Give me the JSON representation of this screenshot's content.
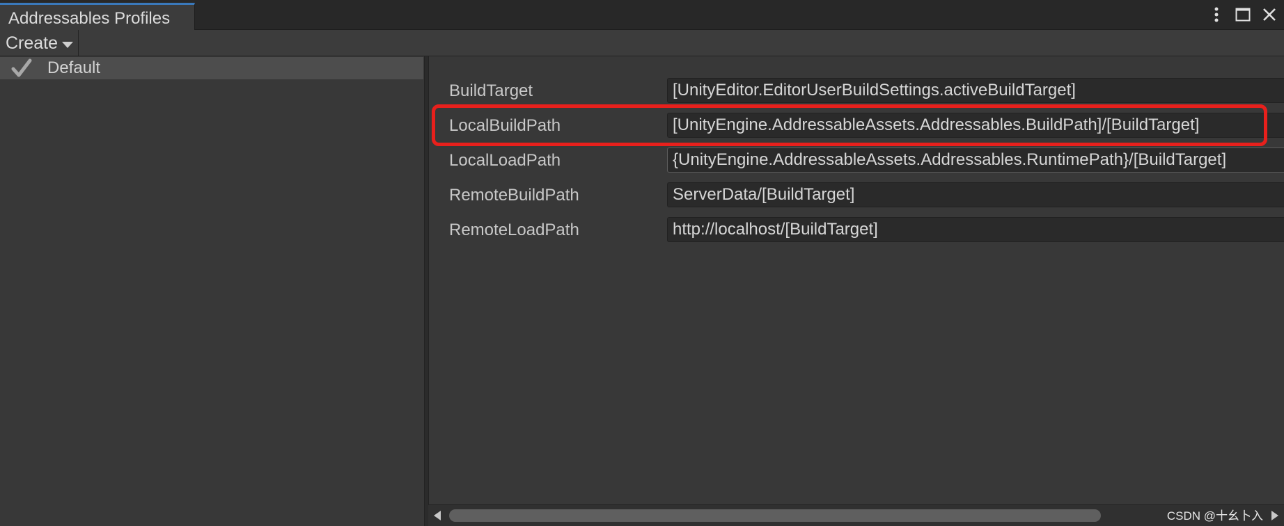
{
  "window": {
    "tab_title": "Addressables Profiles",
    "icons": [
      "more-vert-icon",
      "maximize-icon",
      "close-icon"
    ]
  },
  "toolbar": {
    "create_label": "Create"
  },
  "profiles": [
    {
      "label": "Default",
      "selected": true,
      "icon": "check-icon"
    }
  ],
  "fields": [
    {
      "label": "BuildTarget",
      "value": "[UnityEditor.EditorUserBuildSettings.activeBuildTarget]"
    },
    {
      "label": "LocalBuildPath",
      "value": "[UnityEngine.AddressableAssets.Addressables.BuildPath]/[BuildTarget]",
      "highlighted": true
    },
    {
      "label": "LocalLoadPath",
      "value": "{UnityEngine.AddressableAssets.Addressables.RuntimePath}/[BuildTarget]",
      "focused": true
    },
    {
      "label": "RemoteBuildPath",
      "value": "ServerData/[BuildTarget]"
    },
    {
      "label": "RemoteLoadPath",
      "value": "http://localhost/[BuildTarget]"
    }
  ],
  "watermark": "CSDN @十幺卜入",
  "colors": {
    "accent_tab": "#3a79bb",
    "highlight_annotation": "#e8201c",
    "background": "#383838"
  }
}
